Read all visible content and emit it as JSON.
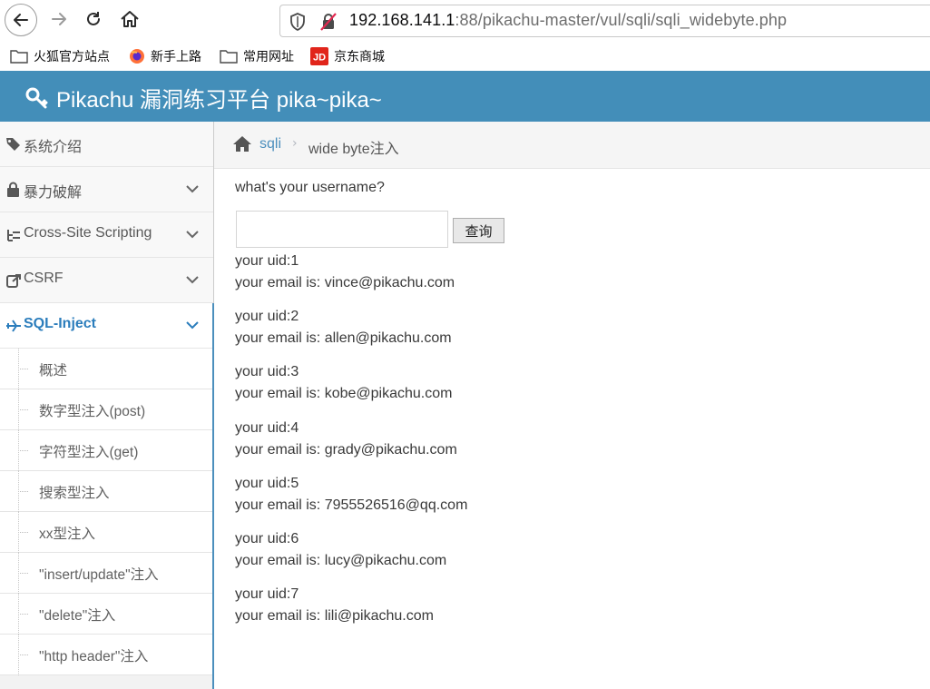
{
  "browser": {
    "url_host": "192.168.141.1",
    "url_rest": ":88/pikachu-master/vul/sqli/sqli_widebyte.php"
  },
  "bookmarks": [
    {
      "label": "火狐官方站点",
      "icon": "folder-icon"
    },
    {
      "label": "新手上路",
      "icon": "firefox-icon"
    },
    {
      "label": "常用网址",
      "icon": "folder-icon"
    },
    {
      "label": "京东商城",
      "icon": "jd-icon"
    }
  ],
  "header": {
    "title": "Pikachu 漏洞练习平台 pika~pika~"
  },
  "sidebar": {
    "items": [
      {
        "label": "系统介绍",
        "icon": "tags-icon"
      },
      {
        "label": "暴力破解",
        "icon": "lock-icon"
      },
      {
        "label": "Cross-Site Scripting",
        "icon": "sitemap-icon"
      },
      {
        "label": "CSRF",
        "icon": "share-icon"
      },
      {
        "label": "SQL-Inject",
        "icon": "plane-icon"
      }
    ],
    "subitems": [
      "概述",
      "数字型注入(post)",
      "字符型注入(get)",
      "搜索型注入",
      "xx型注入",
      "\"insert/update\"注入",
      "\"delete\"注入",
      "\"http header\"注入"
    ]
  },
  "breadcrumb": {
    "link": "sqli",
    "current": "wide byte注入"
  },
  "form": {
    "prompt": "what's your username?",
    "input_value": "",
    "button_label": "查询"
  },
  "results": [
    {
      "uid": "your uid:1",
      "email": "your email is: vince@pikachu.com"
    },
    {
      "uid": "your uid:2",
      "email": "your email is: allen@pikachu.com"
    },
    {
      "uid": "your uid:3",
      "email": "your email is: kobe@pikachu.com"
    },
    {
      "uid": "your uid:4",
      "email": "your email is: grady@pikachu.com"
    },
    {
      "uid": "your uid:5",
      "email": "your email is: 7955526516@qq.com"
    },
    {
      "uid": "your uid:6",
      "email": "your email is: lucy@pikachu.com"
    },
    {
      "uid": "your uid:7",
      "email": "your email is: lili@pikachu.com"
    }
  ],
  "colors": {
    "header": "#438eb9",
    "accent": "#2b7dbc"
  }
}
